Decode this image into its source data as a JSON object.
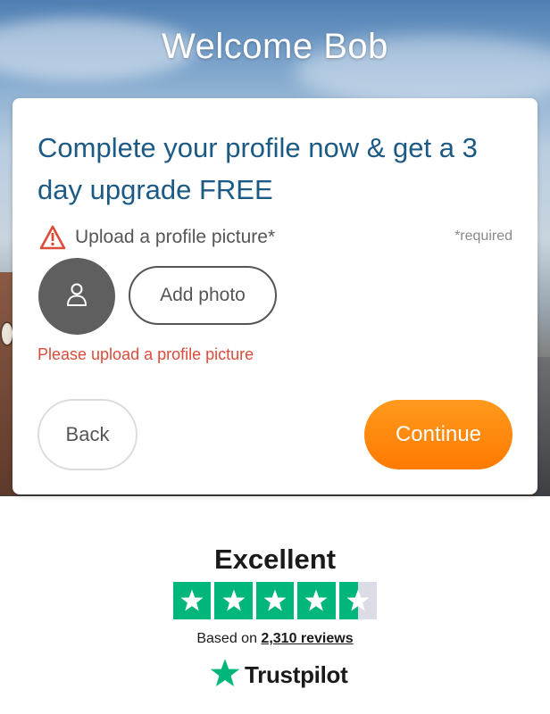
{
  "header": {
    "title": "Welcome Bob"
  },
  "card": {
    "heading": "Complete your profile now & get a 3 day upgrade FREE",
    "upload_label": "Upload a profile picture*",
    "required_note": "*required",
    "add_photo_label": "Add photo",
    "error_message": "Please upload a profile picture",
    "back_label": "Back",
    "continue_label": "Continue"
  },
  "trustpilot": {
    "rating_label": "Excellent",
    "stars": 4.5,
    "based_on_prefix": "Based on",
    "reviews_link": "2,310 reviews",
    "brand": "Trustpilot"
  },
  "colors": {
    "heading": "#1c5a86",
    "error": "#dd4b39",
    "continue": "#ff7a00",
    "trustpilot_green": "#00b67a"
  },
  "icons": {
    "warning": "warning-triangle-icon",
    "avatar": "user-icon",
    "star": "star-icon"
  }
}
